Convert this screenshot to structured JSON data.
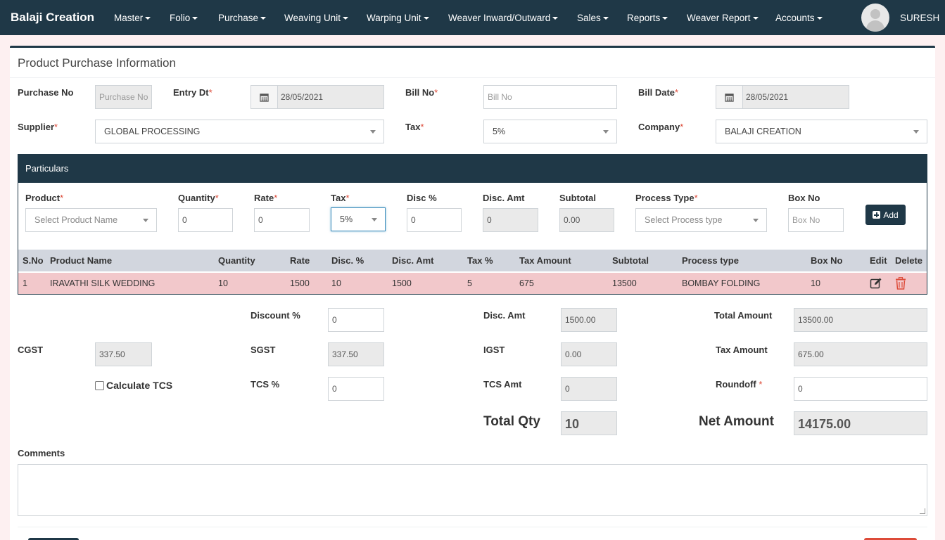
{
  "navbar": {
    "brand": "Balaji Creation",
    "menu": [
      "Master",
      "Folio",
      "Purchase",
      "Weaving Unit",
      "Warping Unit",
      "Weaver Inward/Outward",
      "Sales",
      "Reports",
      "Weaver Report",
      "Accounts"
    ],
    "user": "SURESH"
  },
  "page_title": "Product Purchase Information",
  "header_form": {
    "purchase_no": {
      "label": "Purchase No",
      "placeholder": "Purchase No"
    },
    "entry_dt": {
      "label": "Entry Dt",
      "value": "28/05/2021"
    },
    "bill_no": {
      "label": "Bill No",
      "placeholder": "Bill No"
    },
    "bill_date": {
      "label": "Bill Date",
      "value": "28/05/2021"
    },
    "supplier": {
      "label": "Supplier",
      "value": "GLOBAL PROCESSING"
    },
    "tax": {
      "label": "Tax",
      "value": "5%"
    },
    "company": {
      "label": "Company",
      "value": "BALAJI CREATION"
    }
  },
  "particulars": {
    "title": "Particulars",
    "fields": {
      "product": {
        "label": "Product",
        "placeholder": "Select Product Name"
      },
      "quantity": {
        "label": "Quantity",
        "value": "0"
      },
      "rate": {
        "label": "Rate",
        "value": "0"
      },
      "tax": {
        "label": "Tax",
        "value": "5%"
      },
      "disc_pct": {
        "label": "Disc %",
        "value": "0"
      },
      "disc_amt": {
        "label": "Disc. Amt",
        "value": "0"
      },
      "subtotal": {
        "label": "Subtotal",
        "value": "0.00"
      },
      "process_type": {
        "label": "Process Type",
        "placeholder": "Select Process type"
      },
      "box_no": {
        "label": "Box No",
        "placeholder": "Box No"
      }
    },
    "add_label": "Add",
    "columns": [
      "S.No",
      "Product Name",
      "Quantity",
      "Rate",
      "Disc. %",
      "Disc. Amt",
      "Tax %",
      "Tax Amount",
      "Subtotal",
      "Process type",
      "Box No",
      "Edit",
      "Delete"
    ],
    "rows": [
      [
        "1",
        "IRAVATHI SILK WEDDING",
        "10",
        "1500",
        "10",
        "1500",
        "5",
        "675",
        "13500",
        "BOMBAY FOLDING",
        "10"
      ]
    ]
  },
  "summary": {
    "discount_pct": {
      "label": "Discount %",
      "value": "0"
    },
    "disc_amt": {
      "label": "Disc. Amt",
      "value": "1500.00"
    },
    "total_amount": {
      "label": "Total Amount",
      "value": "13500.00"
    },
    "cgst": {
      "label": "CGST",
      "value": "337.50"
    },
    "sgst": {
      "label": "SGST",
      "value": "337.50"
    },
    "igst": {
      "label": "IGST",
      "value": "0.00"
    },
    "tax_amount": {
      "label": "Tax Amount",
      "value": "675.00"
    },
    "calc_tcs": {
      "label": "Calculate TCS",
      "checked": false
    },
    "tcs_pct": {
      "label": "TCS %",
      "value": "0"
    },
    "tcs_amt": {
      "label": "TCS Amt",
      "value": "0"
    },
    "roundoff": {
      "label": "Roundoff",
      "value": "0"
    },
    "total_qty": {
      "label": "Total Qty",
      "value": "10"
    },
    "net_amount": {
      "label": "Net Amount",
      "value": "14175.00"
    }
  },
  "comments": {
    "label": "Comments",
    "value": ""
  },
  "required_mark": "*",
  "colors": {
    "navbar": "#1f3847",
    "row_highlight": "#f2c8cb",
    "required": "#dd4b39",
    "delete": "#dd4b39"
  }
}
